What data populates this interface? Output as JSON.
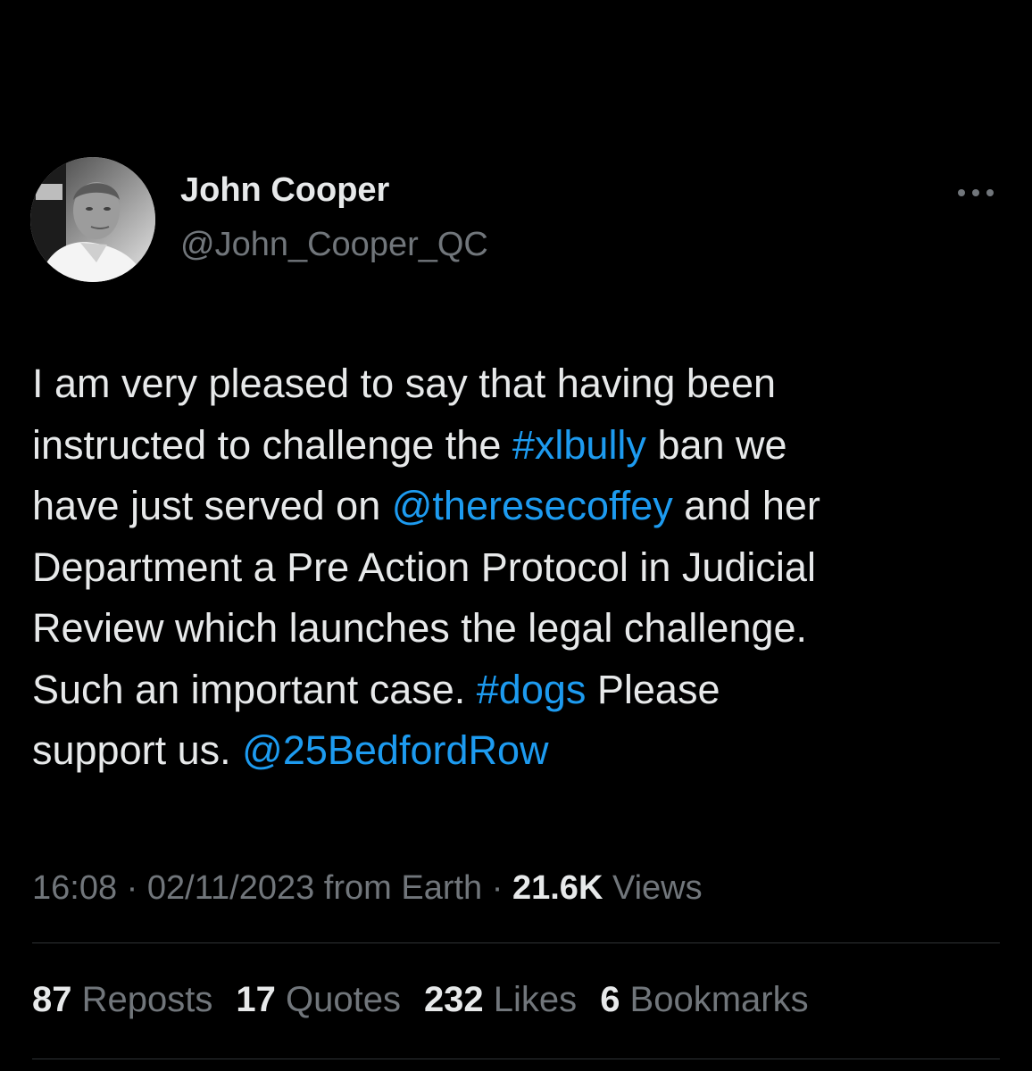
{
  "author": {
    "name": "John Cooper",
    "handle": "@John_Cooper_QC"
  },
  "tweet": {
    "lines": [
      [
        {
          "text": "I am very pleased to say that having been",
          "type": "text"
        }
      ],
      [
        {
          "text": "instructed to challenge the ",
          "type": "text"
        },
        {
          "text": "#xlbully",
          "type": "hashtag"
        },
        {
          "text": " ban we",
          "type": "text"
        }
      ],
      [
        {
          "text": "have just served on ",
          "type": "text"
        },
        {
          "text": "@theresecoffey",
          "type": "mention"
        },
        {
          "text": " and her",
          "type": "text"
        }
      ],
      [
        {
          "text": "Department a Pre Action Protocol in Judicial",
          "type": "text"
        }
      ],
      [
        {
          "text": "Review which launches the legal challenge.",
          "type": "text"
        }
      ],
      [
        {
          "text": "Such an important case. ",
          "type": "text"
        },
        {
          "text": "#dogs",
          "type": "hashtag"
        },
        {
          "text": " Please",
          "type": "text"
        }
      ],
      [
        {
          "text": "support us. ",
          "type": "text"
        },
        {
          "text": "@25BedfordRow",
          "type": "mention"
        }
      ]
    ]
  },
  "meta": {
    "time": "16:08",
    "separator": " · ",
    "date": "02/11/2023",
    "source": " from Earth",
    "views_count": "21.6K",
    "views_label": " Views"
  },
  "stats": [
    {
      "count": "87",
      "label": " Reposts"
    },
    {
      "count": "17",
      "label": " Quotes"
    },
    {
      "count": "232",
      "label": " Likes"
    },
    {
      "count": "6",
      "label": " Bookmarks"
    }
  ],
  "icons": {
    "more": "more-horizontal-icon"
  },
  "colors": {
    "background": "#000000",
    "text": "#e7e9ea",
    "secondary": "#71767b",
    "link": "#1d9bf0",
    "divider": "#2f3336"
  }
}
